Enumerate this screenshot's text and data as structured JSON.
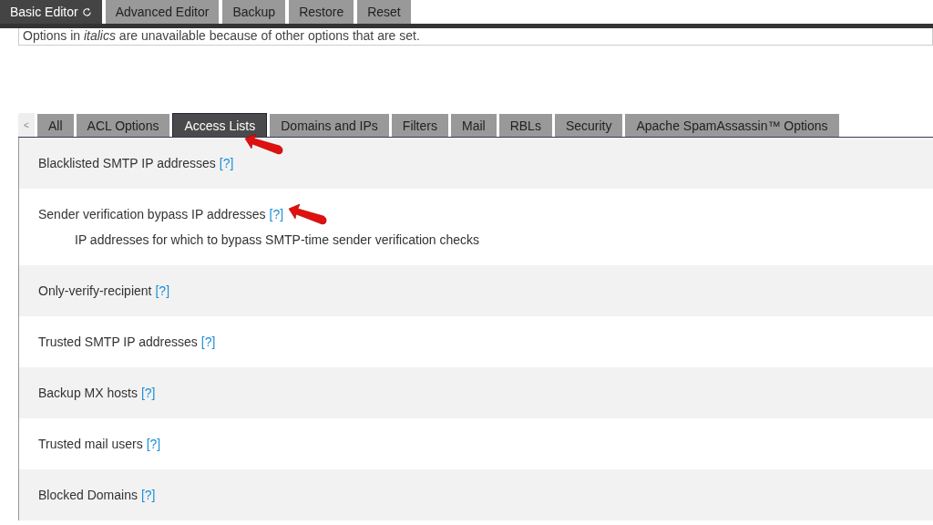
{
  "editor_tabs": [
    {
      "label": "Basic Editor",
      "selected": true,
      "icon": true
    },
    {
      "label": "Advanced Editor",
      "selected": false
    },
    {
      "label": "Backup",
      "selected": false
    },
    {
      "label": "Restore",
      "selected": false
    },
    {
      "label": "Reset",
      "selected": false
    }
  ],
  "notice": "Options in *italics* are unavailable because of other options that are set.",
  "section_tabs": {
    "scroll_left": "<",
    "tabs": [
      {
        "label": "All",
        "selected": false
      },
      {
        "label": "ACL Options",
        "selected": false
      },
      {
        "label": "Access Lists",
        "selected": true
      },
      {
        "label": "Domains and IPs",
        "selected": false
      },
      {
        "label": "Filters",
        "selected": false
      },
      {
        "label": "Mail",
        "selected": false
      },
      {
        "label": "RBLs",
        "selected": false
      },
      {
        "label": "Security",
        "selected": false
      },
      {
        "label": "Apache SpamAssassin™ Options",
        "selected": false
      }
    ]
  },
  "settings": [
    {
      "label": "Blacklisted SMTP IP addresses",
      "help": "[?]"
    },
    {
      "label": "Sender verification bypass IP addresses",
      "help": "[?]",
      "description": "IP addresses for which to bypass SMTP-time sender verification checks"
    },
    {
      "label": "Only-verify-recipient",
      "help": "[?]"
    },
    {
      "label": "Trusted SMTP IP addresses",
      "help": "[?]"
    },
    {
      "label": "Backup MX hosts",
      "help": "[?]"
    },
    {
      "label": "Trusted mail users",
      "help": "[?]"
    },
    {
      "label": "Blocked Domains",
      "help": "[?]"
    }
  ]
}
